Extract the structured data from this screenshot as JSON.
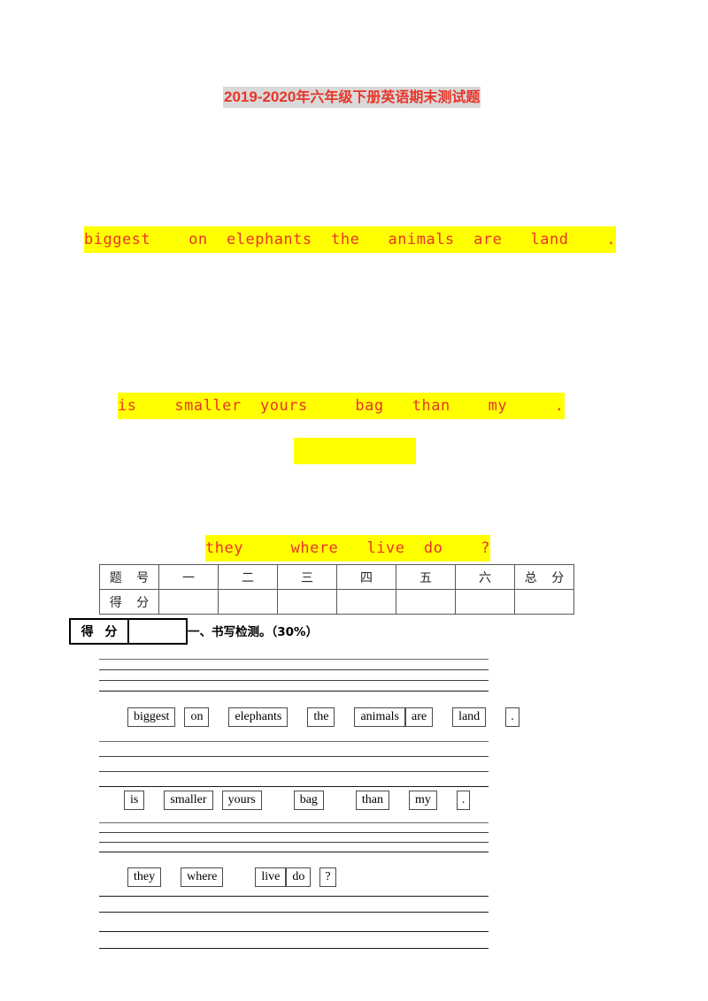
{
  "document": {
    "title_prefix": "2019-2020",
    "title_cn": "年六年级下册英语期末测试题"
  },
  "scrambled_sentences": [
    {
      "id": "sentence-1",
      "text": "biggest    on  elephants  the   animals  are   land    ."
    },
    {
      "id": "sentence-2",
      "text": "is    smaller  yours     bag   than    my     ."
    },
    {
      "id": "sentence-blank",
      "text": ""
    },
    {
      "id": "sentence-3",
      "text": "they     where   live  do    ?"
    }
  ],
  "score_table": {
    "row_labels": [
      "题 号",
      "得 分"
    ],
    "headers": [
      "题 号",
      "一",
      "二",
      "三",
      "四",
      "五",
      "六",
      "总 分"
    ],
    "scores": [
      "得 分",
      "",
      "",
      "",
      "",
      "",
      "",
      ""
    ]
  },
  "score_box": {
    "label": "得 分",
    "value": ""
  },
  "section": {
    "heading": "一、书写检测。（30%）"
  },
  "word_rows": [
    {
      "id": "word-row-1",
      "words": [
        "biggest",
        "on",
        "elephants",
        "the",
        "animals",
        "are",
        "land",
        "."
      ]
    },
    {
      "id": "word-row-2",
      "words": [
        "is",
        "smaller",
        "yours",
        "bag",
        "than",
        "my",
        "."
      ]
    },
    {
      "id": "word-row-3",
      "words": [
        "they",
        "where",
        "live",
        "do",
        "?"
      ]
    }
  ],
  "colors": {
    "title_text": "#e8352a",
    "title_highlight": "#d9d9d9",
    "sentence_text": "#e8352a",
    "sentence_highlight": "#ffff00",
    "rule_line": "#3f3f3f",
    "table_border": "#595959"
  }
}
